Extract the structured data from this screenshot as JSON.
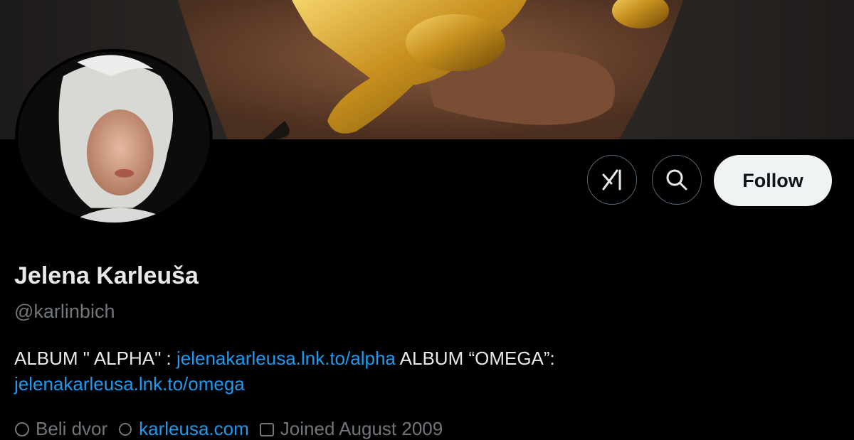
{
  "profile": {
    "name": "Jelena Karleuša",
    "handle": "@karlinbich",
    "bio": {
      "part1": "ALBUM \" ALPHA\" : ",
      "link1": "jelenakarleusa.lnk.to/alpha",
      "part2": " ALBUM “OMEGA”:",
      "link2": "jelenakarleusa.lnk.to/omega"
    },
    "meta": {
      "location": "Beli dvor",
      "website": "karleusa.com",
      "joined": "Joined August 2009"
    }
  },
  "actions": {
    "grok_icon": "grok-icon",
    "search_icon": "search-icon",
    "follow_label": "Follow"
  },
  "colors": {
    "background": "#000000",
    "link": "#1d9bf0",
    "secondary_text": "#71767b",
    "follow_bg": "#eff3f4"
  }
}
